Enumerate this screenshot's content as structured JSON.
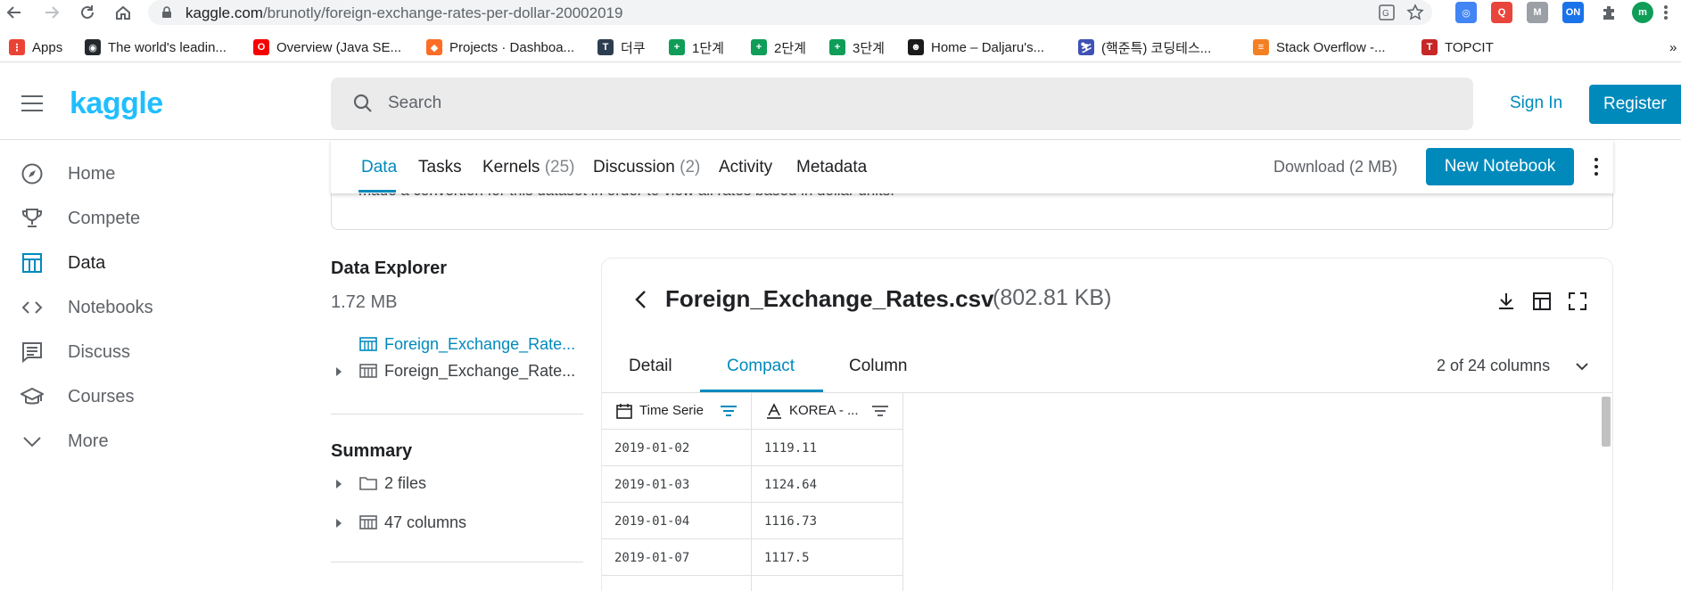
{
  "browser": {
    "url_host": "kaggle.com",
    "url_path": "/brunotly/foreign-exchange-rates-per-dollar-20002019",
    "extensions": [
      {
        "name": "chrome-ext-1",
        "color": "#4285f4",
        "glyph": "◎"
      },
      {
        "name": "chrome-ext-2",
        "color": "#e8453c",
        "glyph": "Q"
      },
      {
        "name": "gmail-ext",
        "color": "#9aa0a6",
        "glyph": "M"
      },
      {
        "name": "calendar-on-ext",
        "color": "#1a73e8",
        "glyph": "ON"
      },
      {
        "name": "profile-avatar",
        "color": "#0f9d58",
        "glyph": "m"
      }
    ],
    "bookmarks": [
      {
        "label": "Apps",
        "icon": "apps-grid-icon",
        "color": "#ea4335",
        "glyph": "⋮"
      },
      {
        "label": "The world's leadin...",
        "icon": "github-icon",
        "color": "#24292e",
        "glyph": "◉"
      },
      {
        "label": "Overview (Java SE...",
        "icon": "oracle-icon",
        "color": "#f80000",
        "glyph": "O"
      },
      {
        "label": "Projects · Dashboa...",
        "icon": "gitlab-icon",
        "color": "#fc6d26",
        "glyph": "◆"
      },
      {
        "label": "더쿠",
        "icon": "theqoo-icon",
        "color": "#2d3e50",
        "glyph": "T"
      },
      {
        "label": "1단계",
        "icon": "plus-sheet-icon",
        "color": "#0f9d58",
        "glyph": "+"
      },
      {
        "label": "2단계",
        "icon": "plus-sheet-icon",
        "color": "#0f9d58",
        "glyph": "+"
      },
      {
        "label": "3단계",
        "icon": "plus-sheet-icon",
        "color": "#0f9d58",
        "glyph": "+"
      },
      {
        "label": "Home – Daljaru's...",
        "icon": "blog-icon",
        "color": "#1b1b1b",
        "glyph": "☻"
      },
      {
        "label": "(핵준특) 코딩테스...",
        "icon": "ski-icon",
        "color": "#3f51b5",
        "glyph": "⛷"
      },
      {
        "label": "Stack Overflow -...",
        "icon": "stackoverflow-icon",
        "color": "#f48024",
        "glyph": "≡"
      },
      {
        "label": "TOPCIT",
        "icon": "topcit-icon",
        "color": "#c62828",
        "glyph": "T"
      }
    ],
    "bookmarks_overflow": "»"
  },
  "header": {
    "logo": "kaggle",
    "search_placeholder": "Search",
    "sign_in": "Sign In",
    "register": "Register"
  },
  "sidebar": {
    "items": [
      {
        "label": "Home",
        "icon": "compass-icon"
      },
      {
        "label": "Compete",
        "icon": "trophy-icon"
      },
      {
        "label": "Data",
        "icon": "table-icon"
      },
      {
        "label": "Notebooks",
        "icon": "code-icon"
      },
      {
        "label": "Discuss",
        "icon": "comment-icon"
      },
      {
        "label": "Courses",
        "icon": "school-icon"
      },
      {
        "label": "More",
        "icon": "chevron-down-icon"
      }
    ]
  },
  "dataset": {
    "description_fragment": "made a convertion for this dataset in order to view all rates based in dollar units.",
    "tabs": [
      {
        "label": "Data",
        "count": ""
      },
      {
        "label": "Tasks",
        "count": ""
      },
      {
        "label": "Kernels",
        "count": "(25)"
      },
      {
        "label": "Discussion",
        "count": "(2)"
      },
      {
        "label": "Activity",
        "count": ""
      },
      {
        "label": "Metadata",
        "count": ""
      }
    ],
    "download": "Download (2 MB)",
    "new_notebook": "New Notebook"
  },
  "explorer": {
    "title": "Data Explorer",
    "size": "1.72 MB",
    "files": [
      {
        "name": "Foreign_Exchange_Rate..."
      },
      {
        "name": "Foreign_Exchange_Rate..."
      }
    ],
    "summary_title": "Summary",
    "summary": [
      {
        "label": "2 files"
      },
      {
        "label": "47 columns"
      }
    ]
  },
  "preview": {
    "filename": "Foreign_Exchange_Rates.csv",
    "filesize": "(802.81 KB)",
    "tabs": [
      "Detail",
      "Compact",
      "Column"
    ],
    "columns_count": "2 of 24 columns",
    "columns": [
      "Time Serie",
      "KOREA - ..."
    ],
    "rows": [
      [
        "2019-01-02",
        "1119.11"
      ],
      [
        "2019-01-03",
        "1124.64"
      ],
      [
        "2019-01-04",
        "1116.73"
      ],
      [
        "2019-01-07",
        "1117.5"
      ]
    ]
  },
  "colors": {
    "kaggle_blue": "#20beff",
    "accent": "#008abc"
  }
}
